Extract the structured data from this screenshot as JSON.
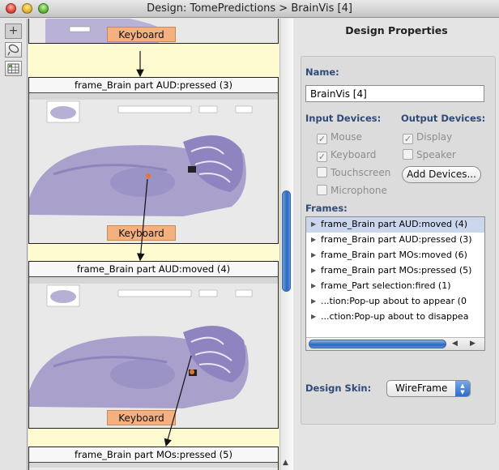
{
  "window": {
    "title": "Design: TomePredictions > BrainVis [4]"
  },
  "canvas": {
    "keyboard_label": "Keyboard",
    "frames": [
      {
        "title": "frame_Brain part AUD:pressed (3)"
      },
      {
        "title": "frame_Brain part AUD:moved (4)"
      },
      {
        "title": "frame_Brain part MOs:pressed (5)"
      }
    ]
  },
  "properties": {
    "heading": "Design Properties",
    "name_label": "Name:",
    "name_value": "BrainVis [4]",
    "input_devices_label": "Input Devices:",
    "output_devices_label": "Output Devices:",
    "input_devices": [
      {
        "label": "Mouse",
        "checked": true
      },
      {
        "label": "Keyboard",
        "checked": true
      },
      {
        "label": "Touchscreen",
        "checked": false
      },
      {
        "label": "Microphone",
        "checked": false
      }
    ],
    "output_devices": [
      {
        "label": "Display",
        "checked": true
      },
      {
        "label": "Speaker",
        "checked": false
      }
    ],
    "add_devices_label": "Add Devices...",
    "frames_label": "Frames:",
    "frames": [
      "frame_Brain part AUD:moved (4)",
      "frame_Brain part AUD:pressed (3)",
      "frame_Brain part MOs:moved (6)",
      "frame_Brain part MOs:pressed (5)",
      "frame_Part selection:fired (1)",
      "...tion:Pop-up about to appear (0",
      "...ction:Pop-up about to disappea"
    ],
    "selected_frame_index": 0,
    "design_skin_label": "Design Skin:",
    "design_skin_value": "WireFrame"
  },
  "colors": {
    "canvas_bg": "#fffbd0",
    "keyboard_fill": "#f4b07f",
    "label_blue": "#2f4a78",
    "selection": "#c9d6ec",
    "scroll_thumb": "#2a67c0"
  },
  "icons": {
    "tool_1": "plus-icon",
    "tool_2": "lasso-icon",
    "tool_3": "grid-icon"
  }
}
